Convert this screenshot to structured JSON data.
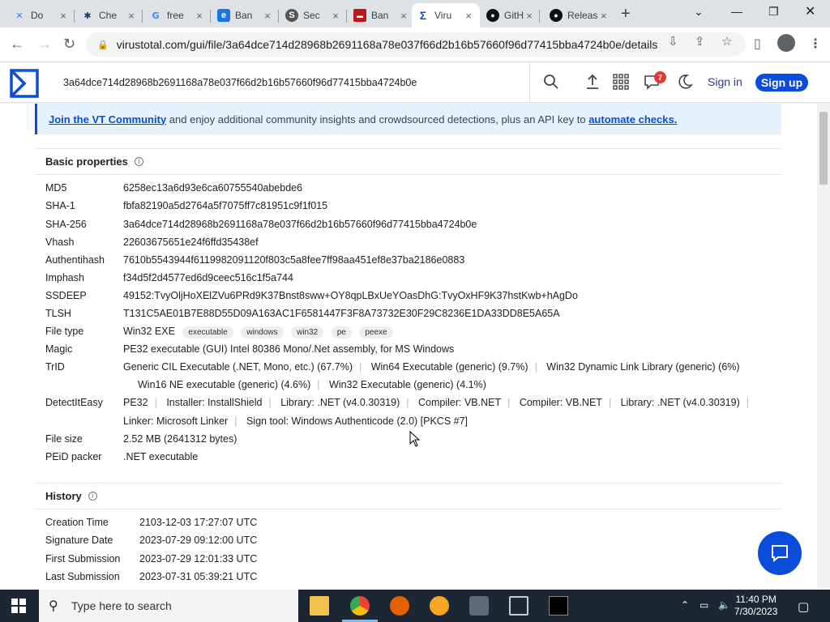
{
  "browser": {
    "tabs": [
      {
        "title": "Do",
        "favicon": "confluence-icon",
        "color": "#2684ff"
      },
      {
        "title": "Che",
        "favicon": "gear-icon",
        "color": "#1a3a6b"
      },
      {
        "title": "free",
        "favicon": "google-icon",
        "color": "#4285f4"
      },
      {
        "title": "Ban",
        "favicon": "edge-doc-icon",
        "color": "#1a73e8"
      },
      {
        "title": "Sec",
        "favicon": "security-icon",
        "color": "#444"
      },
      {
        "title": "Ban",
        "favicon": "ban-icon",
        "color": "#b71c1c"
      },
      {
        "title": "Viru",
        "favicon": "virustotal-icon",
        "color": "#0b4dda"
      },
      {
        "title": "GitH",
        "favicon": "github-icon",
        "color": "#111"
      },
      {
        "title": "Release",
        "favicon": "github-icon",
        "color": "#111"
      }
    ],
    "url": "virustotal.com/gui/file/3a64dce714d28968b2691168a78e037f66d2b16b57660f96d77415bba4724b0e/details"
  },
  "vt": {
    "search_value": "3a64dce714d28968b2691168a78e037f66d2b16b57660f96d77415bba4724b0e",
    "notifications": "7",
    "signin": "Sign in",
    "signup": "Sign up",
    "banner": {
      "link1": "Join the VT Community",
      "text": " and enjoy additional community insights and crowdsourced detections, plus an API key to ",
      "link2": "automate checks."
    }
  },
  "basic": {
    "title": "Basic properties",
    "md5_k": "MD5",
    "md5": "6258ec13a6d93e6ca60755540abebde6",
    "sha1_k": "SHA-1",
    "sha1": "fbfa82190a5d2764a5f7075ff7c81951c9f1f015",
    "sha256_k": "SHA-256",
    "sha256": "3a64dce714d28968b2691168a78e037f66d2b16b57660f96d77415bba4724b0e",
    "vhash_k": "Vhash",
    "vhash": "22603675651e24f6ffd35438ef",
    "auth_k": "Authentihash",
    "auth": "7610b5543944f6119982091120f803c5a8fee7ff98aa451ef8e37ba2186e0883",
    "imphash_k": "Imphash",
    "imphash": "f34d5f2d4577ed6d9ceec516c1f5a744",
    "ssdeep_k": "SSDEEP",
    "ssdeep": "49152:TvyOljHoXElZVu6PRd9K37Bnst8sww+OY8qpLBxUeYOasDhG:TvyOxHF9K37hstKwb+hAgDo",
    "tlsh_k": "TLSH",
    "tlsh": "T131C5AE01B7E88D55D09A163AC1F6581447F3F8A73732E30F29C8236E1DA33DD8E5A65A",
    "filetype_k": "File type",
    "filetype": "Win32 EXE",
    "filetype_tags": [
      "executable",
      "windows",
      "win32",
      "pe",
      "peexe"
    ],
    "magic_k": "Magic",
    "magic": "PE32 executable (GUI) Intel 80386 Mono/.Net assembly, for MS Windows",
    "trid_k": "TrID",
    "trid": [
      "Generic CIL Executable (.NET, Mono, etc.) (67.7%)",
      "Win64 Executable (generic) (9.7%)",
      "Win32 Dynamic Link Library (generic) (6%)",
      "Win16 NE executable (generic) (4.6%)",
      "Win32 Executable (generic) (4.1%)"
    ],
    "die_k": "DetectItEasy",
    "die": [
      "PE32",
      "Installer: InstallShield",
      "Library: .NET (v4.0.30319)",
      "Compiler: VB.NET",
      "Compiler: VB.NET",
      "Library: .NET (v4.0.30319)",
      "Linker: Microsoft Linker",
      "Sign tool: Windows Authenticode (2.0) [PKCS #7]"
    ],
    "filesize_k": "File size",
    "filesize": "2.52 MB (2641312 bytes)",
    "peid_k": "PEiD packer",
    "peid": ".NET executable"
  },
  "history": {
    "title": "History",
    "creation_k": "Creation Time",
    "creation": "2103-12-03 17:27:07 UTC",
    "signature_k": "Signature Date",
    "signature": "2023-07-29 09:12:00 UTC",
    "first_k": "First Submission",
    "first": "2023-07-29 12:01:33 UTC",
    "last_k": "Last Submission",
    "last": "2023-07-31 05:39:21 UTC"
  },
  "taskbar": {
    "search_placeholder": "Type here to search",
    "time": "11:40 PM",
    "date": "7/30/2023"
  }
}
